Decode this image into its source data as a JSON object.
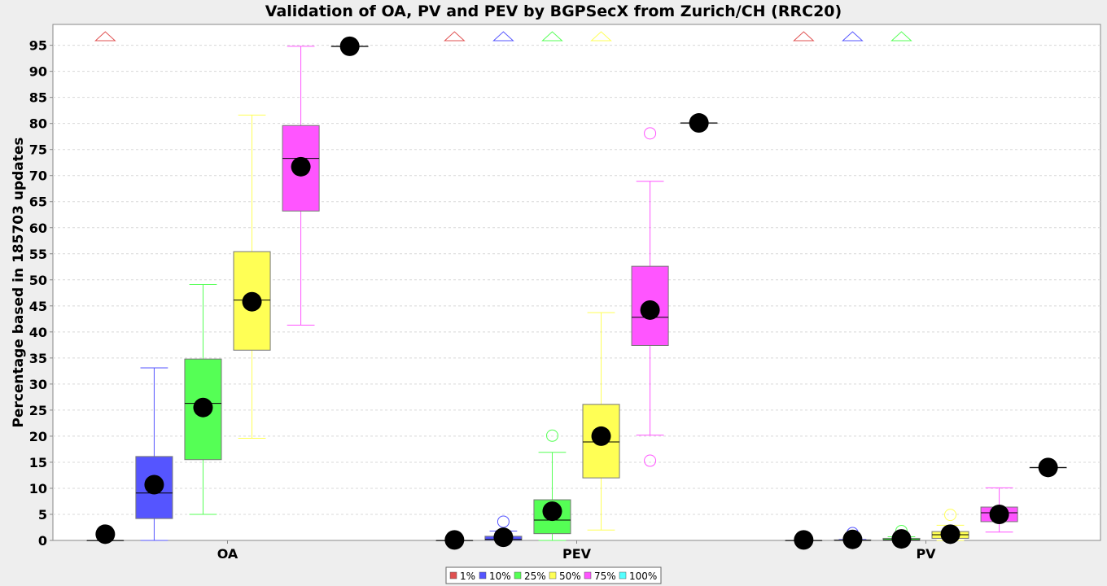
{
  "chart_data": {
    "type": "box",
    "title": "Validation of OA, PV and PEV by BGPSecX from Zurich/CH (RRC20)",
    "xlabel": "",
    "ylabel": "Percentage based in 185703 updates",
    "ylim": [
      0,
      99
    ],
    "yticks": [
      0,
      5,
      10,
      15,
      20,
      25,
      30,
      35,
      40,
      45,
      50,
      55,
      60,
      65,
      70,
      75,
      80,
      85,
      90,
      95
    ],
    "grid": true,
    "legend_position": "bottom",
    "categories": [
      "OA",
      "PEV",
      "PV"
    ],
    "series": [
      {
        "name": "1%",
        "color": "#e05050",
        "boxes": [
          {
            "q1": 0,
            "median": 0,
            "q3": 0,
            "whisker_low": 0,
            "whisker_high": 0,
            "mean": 1.2,
            "outliers": [],
            "offscale_above": true
          },
          {
            "q1": 0,
            "median": 0,
            "q3": 0,
            "whisker_low": 0,
            "whisker_high": 0,
            "mean": 0.1,
            "outliers": [],
            "offscale_above": true
          },
          {
            "q1": 0,
            "median": 0,
            "q3": 0,
            "whisker_low": 0,
            "whisker_high": 0,
            "mean": 0.1,
            "outliers": [],
            "offscale_above": true
          }
        ]
      },
      {
        "name": "10%",
        "color": "#5555ff",
        "boxes": [
          {
            "q1": 4.2,
            "median": 9.1,
            "q3": 16.1,
            "whisker_low": 0,
            "whisker_high": 33.1,
            "mean": 10.7,
            "outliers": [],
            "offscale_above": false
          },
          {
            "q1": 0,
            "median": 0.2,
            "q3": 0.8,
            "whisker_low": 0,
            "whisker_high": 1.8,
            "mean": 0.6,
            "outliers": [
              3.6
            ],
            "offscale_above": true
          },
          {
            "q1": 0,
            "median": 0,
            "q3": 0.1,
            "whisker_low": 0,
            "whisker_high": 0.2,
            "mean": 0.2,
            "outliers": [
              1.4
            ],
            "offscale_above": true
          }
        ]
      },
      {
        "name": "25%",
        "color": "#55ff55",
        "boxes": [
          {
            "q1": 15.5,
            "median": 26.3,
            "q3": 34.8,
            "whisker_low": 5.0,
            "whisker_high": 49.1,
            "mean": 25.5,
            "outliers": [],
            "offscale_above": false
          },
          {
            "q1": 1.3,
            "median": 3.9,
            "q3": 7.8,
            "whisker_low": 0,
            "whisker_high": 16.9,
            "mean": 5.6,
            "outliers": [
              20.1
            ],
            "offscale_above": true
          },
          {
            "q1": 0,
            "median": 0.1,
            "q3": 0.4,
            "whisker_low": 0,
            "whisker_high": 0.7,
            "mean": 0.3,
            "outliers": [
              1.8
            ],
            "offscale_above": true
          }
        ]
      },
      {
        "name": "50%",
        "color": "#ffff55",
        "boxes": [
          {
            "q1": 36.5,
            "median": 46.1,
            "q3": 55.4,
            "whisker_low": 19.6,
            "whisker_high": 81.6,
            "mean": 45.8,
            "outliers": [],
            "offscale_above": false
          },
          {
            "q1": 12.0,
            "median": 18.9,
            "q3": 26.1,
            "whisker_low": 2.0,
            "whisker_high": 43.7,
            "mean": 20.0,
            "outliers": [],
            "offscale_above": true
          },
          {
            "q1": 0.4,
            "median": 1.1,
            "q3": 1.7,
            "whisker_low": 0,
            "whisker_high": 2.9,
            "mean": 1.2,
            "outliers": [
              4.9
            ],
            "offscale_above": false
          }
        ]
      },
      {
        "name": "75%",
        "color": "#ff55ff",
        "boxes": [
          {
            "q1": 63.2,
            "median": 73.3,
            "q3": 79.6,
            "whisker_low": 41.3,
            "whisker_high": 94.8,
            "mean": 71.7,
            "outliers": [],
            "offscale_above": false
          },
          {
            "q1": 37.4,
            "median": 42.8,
            "q3": 52.6,
            "whisker_low": 20.2,
            "whisker_high": 68.9,
            "mean": 44.2,
            "outliers": [
              15.3,
              78.1
            ],
            "offscale_above": false
          },
          {
            "q1": 3.6,
            "median": 5.3,
            "q3": 6.4,
            "whisker_low": 1.6,
            "whisker_high": 10.1,
            "mean": 5.0,
            "outliers": [],
            "offscale_above": false
          }
        ]
      },
      {
        "name": "100%",
        "color": "#55ffff",
        "boxes": [
          {
            "q1": 94.8,
            "median": 94.8,
            "q3": 94.8,
            "whisker_low": 94.8,
            "whisker_high": 94.8,
            "mean": 94.8,
            "outliers": [],
            "offscale_above": false
          },
          {
            "q1": 80.1,
            "median": 80.1,
            "q3": 80.1,
            "whisker_low": 80.1,
            "whisker_high": 80.1,
            "mean": 80.1,
            "outliers": [],
            "offscale_above": false
          },
          {
            "q1": 14.0,
            "median": 14.0,
            "q3": 14.0,
            "whisker_low": 14.0,
            "whisker_high": 14.0,
            "mean": 14.0,
            "outliers": [],
            "offscale_above": false
          }
        ]
      }
    ]
  }
}
